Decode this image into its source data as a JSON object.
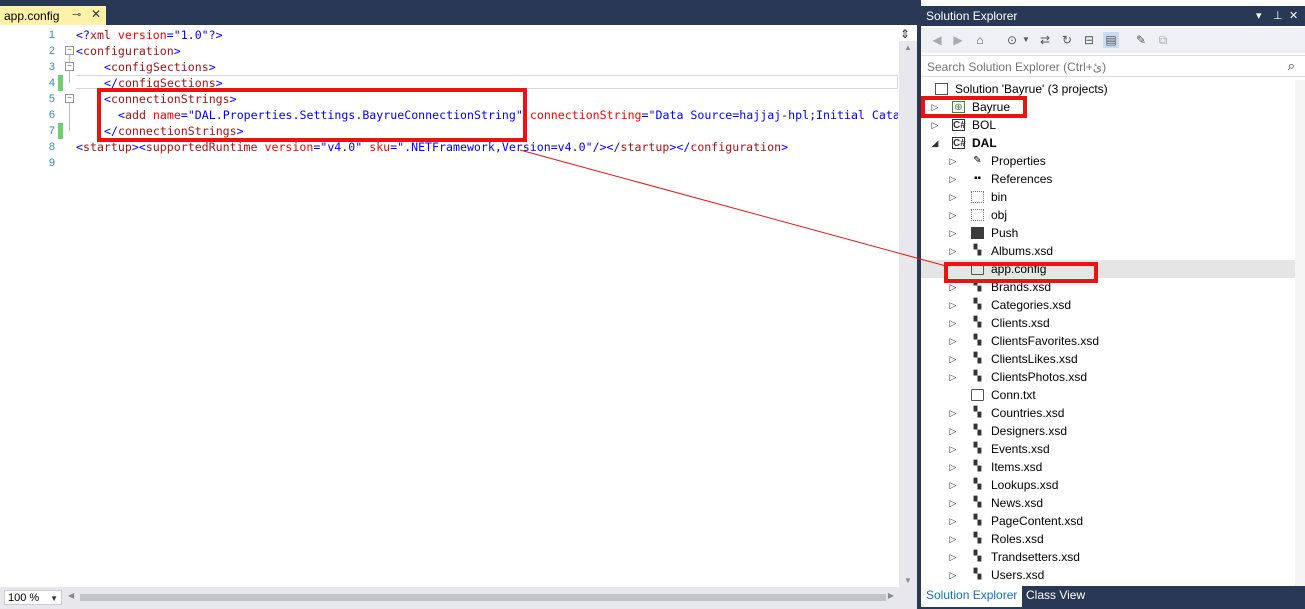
{
  "editor": {
    "tab": {
      "label": "app.config",
      "pin_glyph": "⊸",
      "close_glyph": "✕"
    },
    "line_numbers": [
      "1",
      "2",
      "3",
      "4",
      "5",
      "6",
      "7",
      "8",
      "9"
    ],
    "lines": {
      "l1": {
        "a": "<?",
        "b": "xml",
        "c": " version",
        "d": "=",
        "e": "\"1.0\"",
        "f": "?>"
      },
      "l2": {
        "a": "<",
        "b": "configuration",
        "c": ">"
      },
      "l3": {
        "a": "<",
        "b": "configSections",
        "c": ">"
      },
      "l4": {
        "a": "</",
        "b": "configSections",
        "c": ">"
      },
      "l5": {
        "a": "<",
        "b": "connectionStrings",
        "c": ">"
      },
      "l6": {
        "a": "<",
        "b": "add",
        "c": " name",
        "d": "=",
        "e": "\"DAL.Properties.Settings.BayrueConnectionString\"",
        "f": " connectionString",
        "g": "=",
        "h": "\"Data Source=hajjaj-hpl;Initial Cata"
      },
      "l7": {
        "a": "</",
        "b": "connectionStrings",
        "c": ">"
      },
      "l8": {
        "a": "<",
        "b": "startup",
        "c": "><",
        "d": "supportedRuntime",
        "e": " version",
        "f": "=",
        "g": "\"v4.0\"",
        "h": " sku",
        "i": "=",
        "j": "\".NETFramework,Version=v4.0\"",
        "k": "/></",
        "l": "startup",
        "m": "></",
        "n": "configuration",
        "o": ">"
      }
    },
    "zoom": "100 %"
  },
  "solution_explorer": {
    "title": "Solution Explorer",
    "search_placeholder": "Search Solution Explorer (Ctrl+ئ)",
    "nodes": [
      {
        "label": "Solution 'Bayrue' (3 projects)"
      },
      {
        "label": "Bayrue"
      },
      {
        "label": "BOL"
      },
      {
        "label": "DAL"
      },
      {
        "label": "Properties"
      },
      {
        "label": "References"
      },
      {
        "label": "bin"
      },
      {
        "label": "obj"
      },
      {
        "label": "Push"
      },
      {
        "label": "Albums.xsd"
      },
      {
        "label": "app.config"
      },
      {
        "label": "Brands.xsd"
      },
      {
        "label": "Categories.xsd"
      },
      {
        "label": "Clients.xsd"
      },
      {
        "label": "ClientsFavorites.xsd"
      },
      {
        "label": "ClientsLikes.xsd"
      },
      {
        "label": "ClientsPhotos.xsd"
      },
      {
        "label": "Conn.txt"
      },
      {
        "label": "Countries.xsd"
      },
      {
        "label": "Designers.xsd"
      },
      {
        "label": "Events.xsd"
      },
      {
        "label": "Items.xsd"
      },
      {
        "label": "Lookups.xsd"
      },
      {
        "label": "News.xsd"
      },
      {
        "label": "PageContent.xsd"
      },
      {
        "label": "Roles.xsd"
      },
      {
        "label": "Trandsetters.xsd"
      },
      {
        "label": "Users.xsd"
      }
    ],
    "bottom_tabs": [
      "Solution Explorer",
      "Class View"
    ]
  },
  "colors": {
    "accent_bg": "#293955",
    "tab_active": "#fff1a8",
    "annotation": "#ee1111"
  }
}
